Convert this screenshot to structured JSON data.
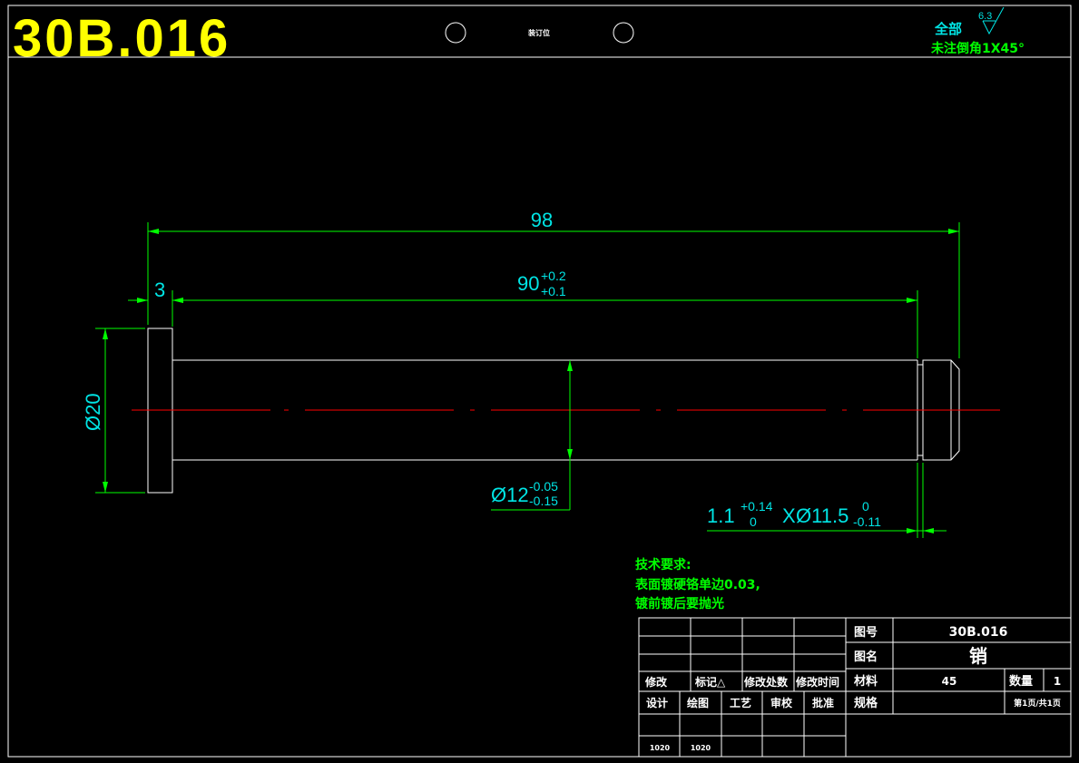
{
  "drawing_number_large": "30B.016",
  "binding_label": "装订位",
  "surface_finish": {
    "scope_label": "全部",
    "roughness_value": "6.3"
  },
  "chamfer_note": "未注倒角1X45°",
  "dimensions": {
    "overall_length": "98",
    "head_thickness": "3",
    "shaft_length": {
      "nominal": "90",
      "upper": "+0.2",
      "lower": "+0.1"
    },
    "head_diameter": "Ø20",
    "shaft_diameter": {
      "nominal": "Ø12",
      "upper": "-0.05",
      "lower": "-0.15"
    },
    "groove": {
      "width_nominal": "1.1",
      "width_upper": "+0.14",
      "width_lower": "0",
      "separator": "X",
      "diameter_nominal": "Ø11.5",
      "diameter_upper": "0",
      "diameter_lower": "-0.11"
    }
  },
  "tech_requirements": {
    "title": "技术要求:",
    "line1": "表面镀硬铬单边0.03,",
    "line2": "镀前镀后要抛光"
  },
  "title_block": {
    "drawing_no_label": "图号",
    "drawing_no_value": "30B.016",
    "part_name_label": "图名",
    "part_name_value": "销",
    "material_label": "材料",
    "material_value": "45",
    "quantity_label": "数量",
    "quantity_value": "1",
    "spec_label": "规格",
    "page_info": "第1页/共1页",
    "revision_headers": [
      "修改",
      "标记△",
      "修改处数",
      "修改时间"
    ],
    "role_headers": [
      "设计",
      "绘图",
      "工艺",
      "审校",
      "批准"
    ],
    "dates": [
      "1020",
      "1020"
    ]
  }
}
